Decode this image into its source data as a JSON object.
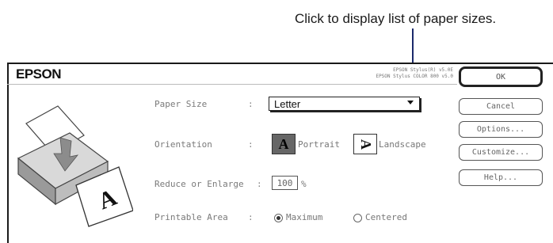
{
  "callout": {
    "text": "Click to display list of paper sizes."
  },
  "dialog": {
    "brand": "EPSON",
    "version_line1": "EPSON Stylus(R) v5.0E",
    "version_line2": "EPSON Stylus COLOR 800 v5.0"
  },
  "paper_size": {
    "label": "Paper Size",
    "colon": ":",
    "value": "Letter"
  },
  "orientation": {
    "label": "Orientation",
    "colon": ":",
    "portrait_label": "Portrait",
    "landscape_label": "Landscape",
    "portrait_glyph": "A",
    "landscape_glyph": "A",
    "selected": "Portrait"
  },
  "reduce_enlarge": {
    "label": "Reduce or Enlarge",
    "colon": ":",
    "value": "100",
    "unit": "%"
  },
  "printable_area": {
    "label": "Printable Area",
    "colon": ":",
    "option_maximum": "Maximum",
    "option_centered": "Centered",
    "selected": "Maximum"
  },
  "buttons": {
    "ok": "OK",
    "cancel": "Cancel",
    "options": "Options...",
    "customize": "Customize...",
    "help": "Help..."
  },
  "printer_preview": {
    "page_glyph": "A"
  },
  "colors": {
    "leader_line": "#1b2a6b",
    "border": "#1a1a1a"
  }
}
